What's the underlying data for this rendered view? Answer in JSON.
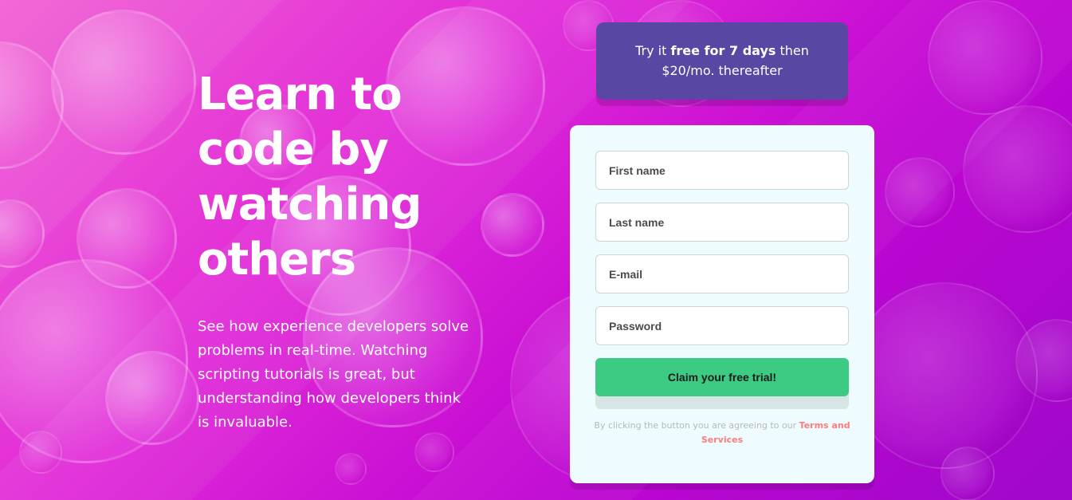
{
  "colors": {
    "background_start": "#f05fd3",
    "background_end": "#9f08c9",
    "promo_background": "#5a46a3",
    "form_background": "#eefcff",
    "cta_background": "#3dcb83",
    "terms_link": "#ff7b7b"
  },
  "hero": {
    "title_lines": [
      "Learn to",
      "code by",
      "watching",
      "others"
    ],
    "description_lines": [
      "See how experience developers solve",
      "problems in real-time. Watching",
      "scripting tutorials is great, but",
      "understanding how developers think",
      "is invaluable."
    ]
  },
  "promo": {
    "prefix": "Try it ",
    "strong": "free for 7 days",
    "suffix_line1": " then",
    "line2": "$20/mo. thereafter"
  },
  "form": {
    "fields": {
      "first_name": "First name",
      "last_name": "Last name",
      "email": "E-mail",
      "password": "Password"
    },
    "cta_label": "Claim your free trial!",
    "terms_prefix": "By clicking the button you are agreeing to our ",
    "terms_link": "Terms and Services"
  }
}
